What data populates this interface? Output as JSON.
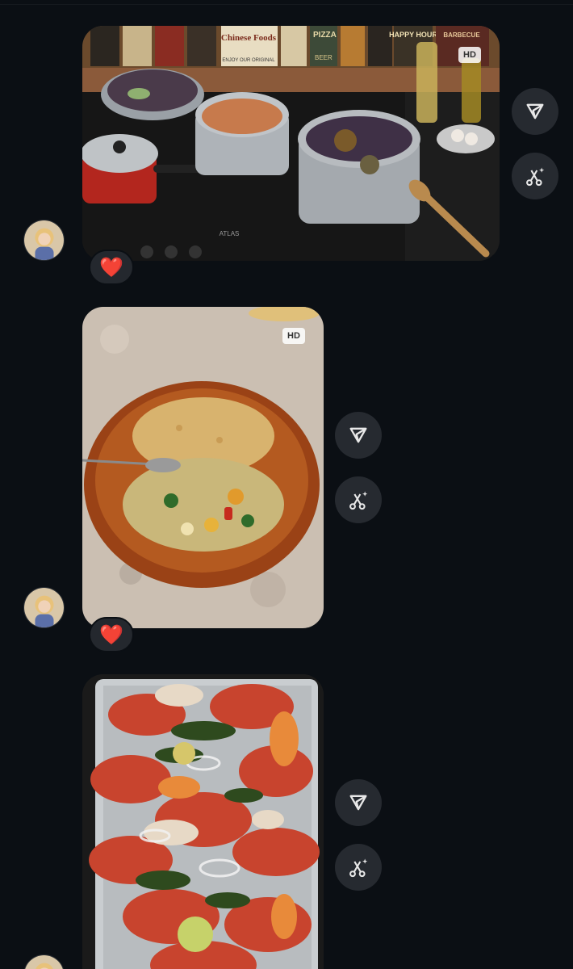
{
  "messages": [
    {
      "hd_badge": "HD",
      "reaction": "❤️",
      "share_icon": "send-icon",
      "edit_icon": "ai-edit-icon"
    },
    {
      "hd_badge": "HD",
      "reaction": "❤️",
      "share_icon": "send-icon",
      "edit_icon": "ai-edit-icon"
    },
    {
      "share_icon": "send-icon",
      "edit_icon": "ai-edit-icon"
    }
  ],
  "photo_labels": {
    "sign1": "Chinese Foods",
    "sign2": "ENJOY OUR ORIGINAL",
    "sign3": "HAPPY HOUR",
    "sign4": "BARBECUE",
    "sign5": "PIZZA",
    "sign6": "BEER",
    "stove_brand": "ATLAS"
  },
  "colors": {
    "background": "#0b0f14",
    "button_bg": "#262a30",
    "reaction_bg": "#24282e",
    "heart": "#e0243c"
  }
}
